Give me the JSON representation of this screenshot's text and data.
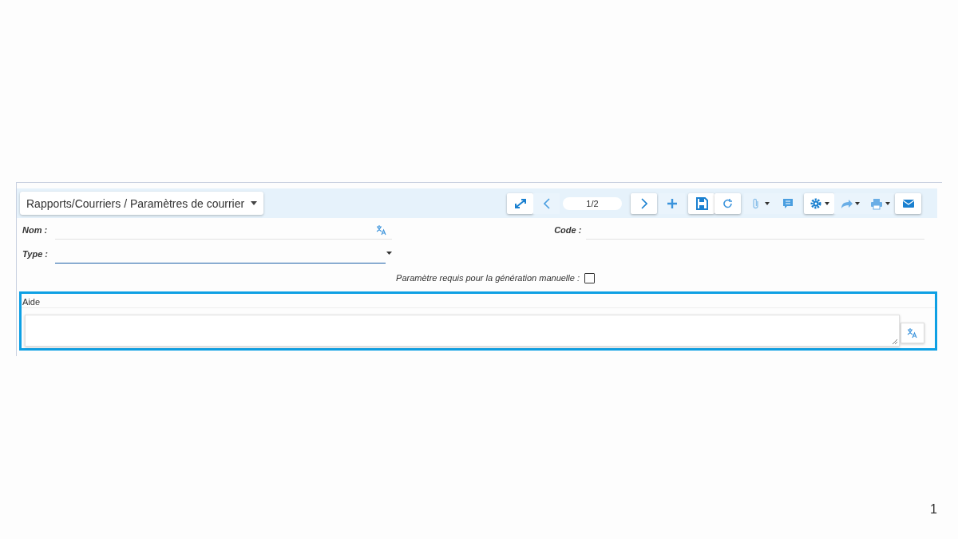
{
  "breadcrumb": {
    "label": "Rapports/Courriers / Paramètres de courrier"
  },
  "toolbar": [
    {
      "kind": "expand",
      "raised": true
    },
    {
      "kind": "prev",
      "raised": false
    },
    {
      "kind": "pager",
      "text": "1/2"
    },
    {
      "kind": "next",
      "raised": true
    },
    {
      "kind": "add",
      "raised": false
    },
    {
      "kind": "save",
      "raised": true
    },
    {
      "kind": "refresh",
      "raised": true
    },
    {
      "kind": "attach",
      "raised": false,
      "caret": true
    },
    {
      "kind": "comment",
      "raised": false
    },
    {
      "kind": "gear",
      "raised": true,
      "caret": true
    },
    {
      "kind": "share",
      "raised": false,
      "caret": true
    },
    {
      "kind": "print",
      "raised": false,
      "caret": true
    },
    {
      "kind": "mail",
      "raised": true
    }
  ],
  "form": {
    "nom": {
      "label": "Nom :"
    },
    "code": {
      "label": "Code :"
    },
    "type": {
      "label": "Type :"
    },
    "required": {
      "label": "Paramètre requis pour la génération manuelle :",
      "checked": false
    },
    "aide": {
      "label": "Aide"
    }
  },
  "page_number": "1"
}
